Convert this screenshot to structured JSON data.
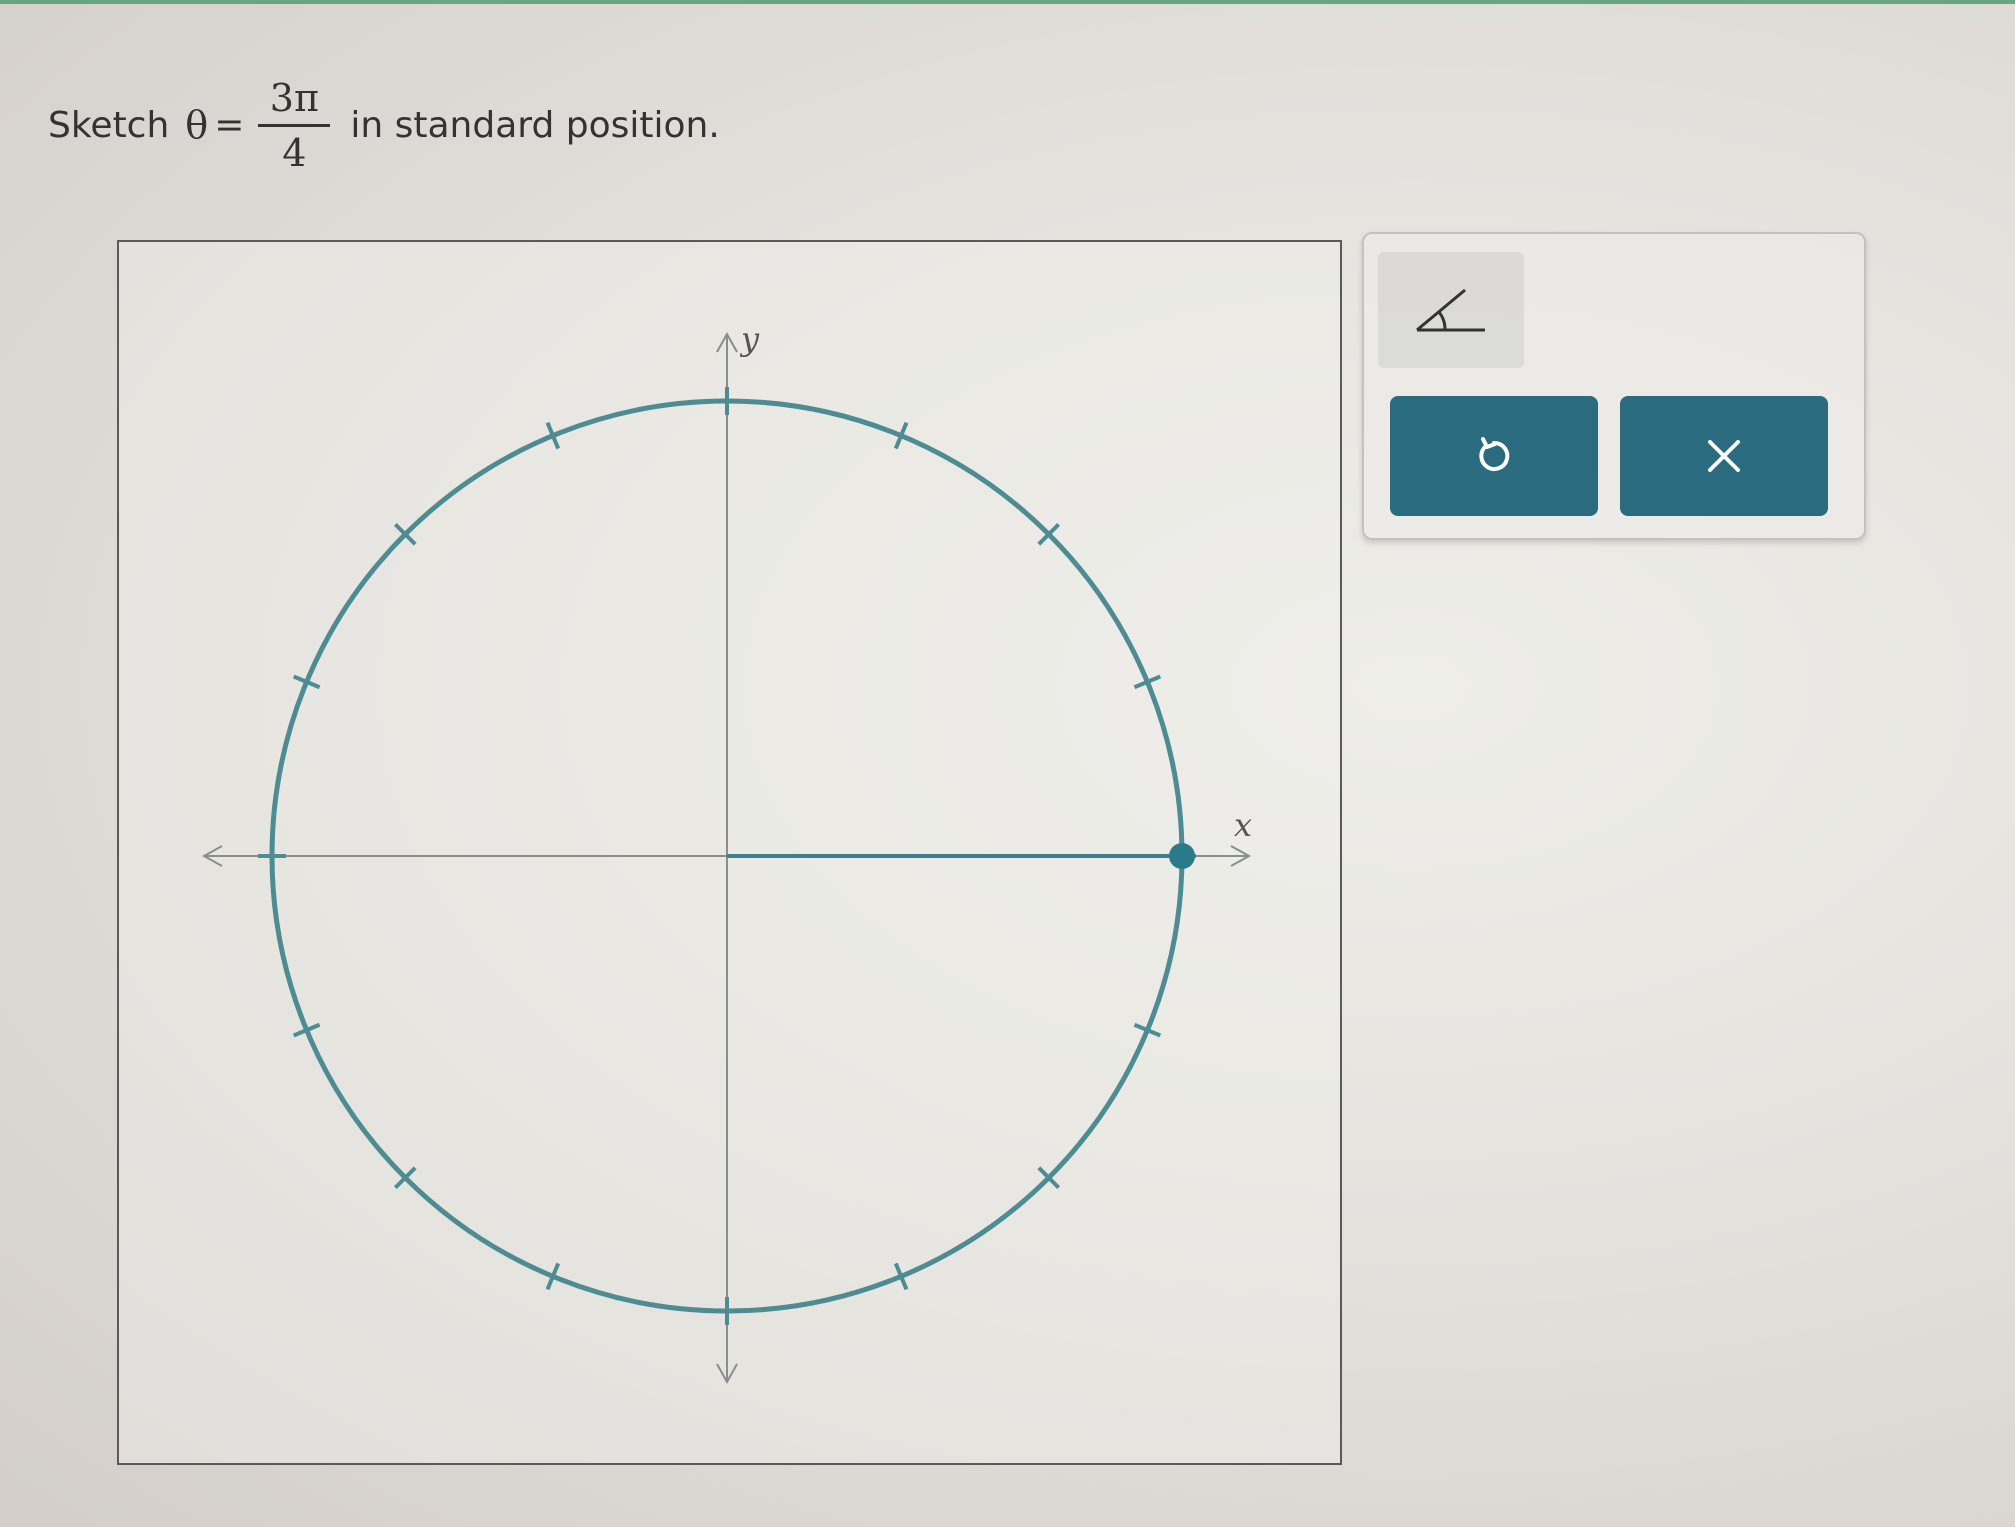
{
  "prompt": {
    "lead": "Sketch",
    "variable": "θ",
    "equals": "=",
    "numerator": "3π",
    "denominator": "4",
    "trail": "in standard position."
  },
  "graph": {
    "x_axis_label": "x",
    "y_axis_label": "y",
    "tick_marks_per_quadrant": 3,
    "initial_side_angle_deg": 0,
    "colors": {
      "circle": "#4c8c92",
      "axes": "#8a8d8e",
      "terminal_ray": "#3d7f8d",
      "point": "#2b7a8a"
    }
  },
  "toolbar": {
    "angle_tool_icon": "angle-icon",
    "undo_icon": "undo-icon",
    "clear_icon": "close-icon",
    "button_color": "#2b6b80"
  }
}
